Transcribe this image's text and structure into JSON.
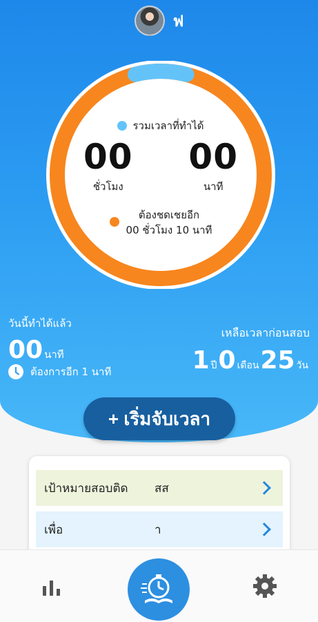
{
  "header": {
    "username": "ฟ"
  },
  "ring": {
    "total_label": "รวมเวลาที่ทำได้",
    "hours_value": "00",
    "hours_unit": "ชั่วโมง",
    "minutes_value": "00",
    "minutes_unit": "นาที",
    "debt_line1": "ต้องชดเชยอีก",
    "debt_line2": "00 ชั่วโมง 10 นาที",
    "completed_fraction": 0.08,
    "colors": {
      "completed": "#63c3f9",
      "remaining": "#f7861e"
    }
  },
  "today": {
    "label": "วันนี้ทำได้แล้ว",
    "value": "00",
    "unit": "นาที",
    "need_text": "ต้องการอีก 1 นาที"
  },
  "remaining": {
    "label": "เหลือเวลาก่อนสอบ",
    "years": "1",
    "years_unit": "ปี",
    "months": "0",
    "months_unit": "เดือน",
    "days": "25",
    "days_unit": "วัน"
  },
  "start_button": {
    "label": "+ เริ่มจับเวลา"
  },
  "goals": [
    {
      "label": "เป้าหมายสอบติด",
      "value": "สส"
    },
    {
      "label": "เพื่อ",
      "value": "า"
    }
  ],
  "bottom_nav": {
    "items": [
      {
        "icon": "bar-chart-icon"
      },
      {
        "icon": "stopwatch-book-icon"
      },
      {
        "icon": "gear-icon"
      }
    ]
  }
}
